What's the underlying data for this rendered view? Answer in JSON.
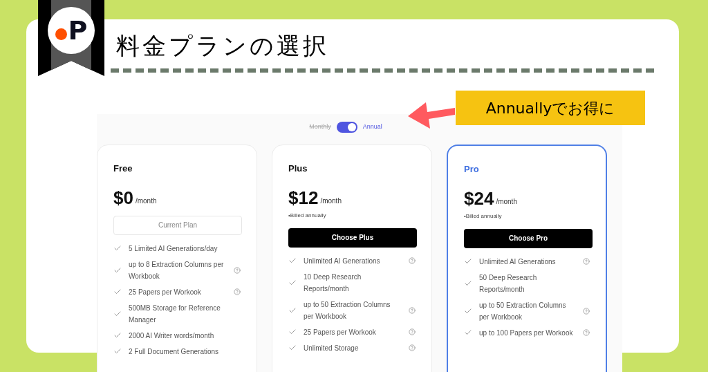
{
  "badge": {
    "logo_text": "P"
  },
  "heading": "料金プランの選択",
  "callout": "Annuallyでお得に",
  "billing_toggle": {
    "left_label": "Monthly",
    "right_label": "Annual",
    "on": true
  },
  "plans": [
    {
      "name": "Free",
      "price": "$0",
      "period": "/month",
      "highlighted": false,
      "button": {
        "label": "Current Plan",
        "kind": "outline"
      },
      "features": [
        {
          "text": "5 Limited AI Generations/day",
          "info": false
        },
        {
          "text": "up to 8 Extraction Columns per Workbook",
          "info": true
        },
        {
          "text": "25 Papers per Workook",
          "info": true
        },
        {
          "text": "500MB Storage for Reference Manager",
          "info": false
        },
        {
          "text": "2000 AI Writer words/month",
          "info": false
        },
        {
          "text": "2 Full Document Generations",
          "info": false
        }
      ]
    },
    {
      "name": "Plus",
      "price": "$12",
      "period": "/month",
      "note": "•Billed annually",
      "highlighted": false,
      "button": {
        "label": "Choose Plus",
        "kind": "primary"
      },
      "features": [
        {
          "text": "Unlimited AI Generations",
          "info": true
        },
        {
          "text": "10 Deep Research Reports/month",
          "info": false
        },
        {
          "text": "up to 50 Extraction Columns per Workbook",
          "info": true
        },
        {
          "text": "25 Papers per Workook",
          "info": true
        },
        {
          "text": "Unlimited Storage",
          "info": true
        }
      ]
    },
    {
      "name": "Pro",
      "price": "$24",
      "period": "/month",
      "note": "•Billed annually",
      "highlighted": true,
      "button": {
        "label": "Choose Pro",
        "kind": "primary"
      },
      "features": [
        {
          "text": "Unlimited AI Generations",
          "info": true
        },
        {
          "text": "50 Deep Research Reports/month",
          "info": false
        },
        {
          "text": "up to 50 Extraction Columns per Workbook",
          "info": true
        },
        {
          "text": "up to 100 Papers per Workook",
          "info": true
        }
      ]
    }
  ]
}
